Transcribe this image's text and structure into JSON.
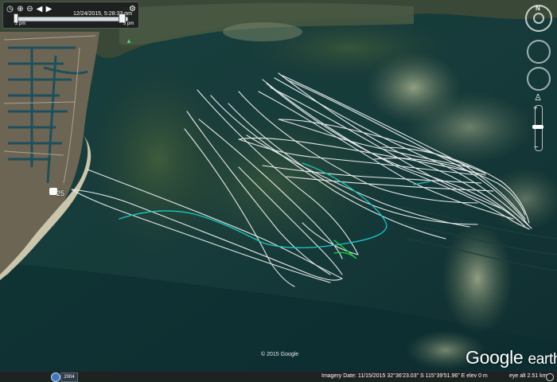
{
  "time_slider": {
    "date_label": "12/24/2015, 5:28:33 pm",
    "start_label": "2 pm",
    "end_label": "5 pm"
  },
  "map": {
    "marker_label": "25"
  },
  "overlay": {
    "copyright": "© 2015 Google",
    "logo_main": "Google",
    "logo_suffix": "earth"
  },
  "status_bar": {
    "year_badge": "2004",
    "imagery_info": "Imagery Date: 11/15/2015    32°36'23.03\" S  115°39'51.96\" E  elev   0 m",
    "eye_alt": "eye alt   2.51 km"
  },
  "navigation": {
    "compass_north": "N"
  },
  "colors": {
    "track_white": "#f3f3f3",
    "track_cyan": "#1ac7c4",
    "track_green": "#1fd44a",
    "water_deep": "#123b3b",
    "shoal": "#8f9f7a"
  }
}
